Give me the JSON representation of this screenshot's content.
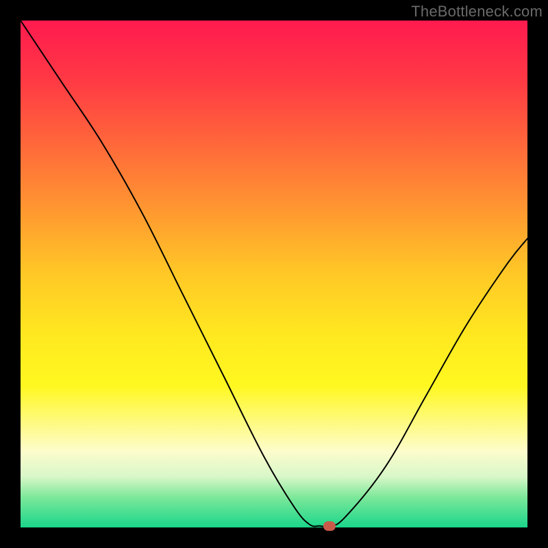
{
  "watermark": "TheBottleneck.com",
  "chart_data": {
    "type": "line",
    "title": "",
    "xlabel": "",
    "ylabel": "",
    "xlim": [
      0,
      100
    ],
    "ylim": [
      0,
      100
    ],
    "grid": false,
    "series": [
      {
        "name": "bottleneck-curve",
        "x": [
          0,
          8,
          16,
          24,
          32,
          40,
          48,
          54,
          57,
          59,
          61,
          64,
          72,
          80,
          88,
          96,
          100
        ],
        "y": [
          100,
          88,
          76,
          62,
          46,
          30,
          14,
          4,
          0.6,
          0.3,
          0.3,
          2,
          12,
          26,
          40,
          52,
          57
        ]
      }
    ],
    "marker": {
      "x": 61,
      "y": 0.3,
      "color": "#c95a4a"
    },
    "gradient_stops": [
      {
        "pos": 0,
        "color": "#ff1a4f"
      },
      {
        "pos": 12,
        "color": "#ff3a44"
      },
      {
        "pos": 25,
        "color": "#ff6a3a"
      },
      {
        "pos": 38,
        "color": "#ff9a30"
      },
      {
        "pos": 50,
        "color": "#ffc826"
      },
      {
        "pos": 62,
        "color": "#ffe820"
      },
      {
        "pos": 72,
        "color": "#fff820"
      },
      {
        "pos": 85,
        "color": "#fdfccc"
      },
      {
        "pos": 90,
        "color": "#d8f7c8"
      },
      {
        "pos": 94,
        "color": "#7de89a"
      },
      {
        "pos": 100,
        "color": "#1ad68a"
      }
    ]
  }
}
